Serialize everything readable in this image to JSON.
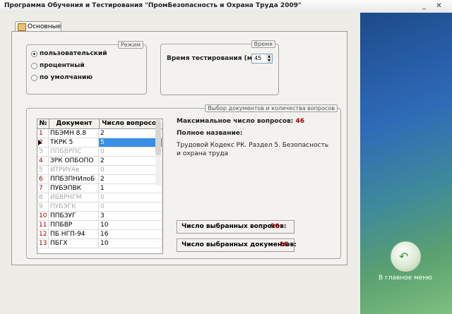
{
  "window": {
    "title": "Программа Обучения и Тестирования \"ПромБезопасность и Охрана Труда 2009\"",
    "minimize": "_",
    "close": "✕"
  },
  "tab": {
    "label": "Основные",
    "icon": "settings-icon"
  },
  "mode_group": {
    "title": "Режим",
    "options": [
      {
        "label": "пользовательский",
        "checked": true
      },
      {
        "label": "процентный",
        "checked": false
      },
      {
        "label": "по умолчанию",
        "checked": false
      }
    ]
  },
  "time_group": {
    "title": "Время",
    "label": "Время тестирования (мин):",
    "value": "45"
  },
  "docs_group": {
    "title": "Выбор документов и количества вопросов",
    "columns": [
      "№",
      "Документ",
      "Число вопросов"
    ],
    "rows": [
      {
        "num": "1",
        "doc": "ПБЭМН 8.8",
        "count": "2",
        "disabled": false,
        "selected": false
      },
      {
        "num": "2",
        "doc": "ТКРК 5",
        "count": "5",
        "disabled": false,
        "selected": true
      },
      {
        "num": "3",
        "doc": "ППБВРПС",
        "count": "0",
        "disabled": true,
        "selected": false
      },
      {
        "num": "4",
        "doc": "ЗРК ОПБОПО",
        "count": "2",
        "disabled": false,
        "selected": false
      },
      {
        "num": "5",
        "doc": "ИТРИУАв",
        "count": "0",
        "disabled": true,
        "selected": false
      },
      {
        "num": "6",
        "doc": "ППБЗПНИлоБ",
        "count": "2",
        "disabled": false,
        "selected": false
      },
      {
        "num": "7",
        "doc": "ПУБЭПВК",
        "count": "1",
        "disabled": false,
        "selected": false
      },
      {
        "num": "8",
        "doc": "ИБВРНГМ",
        "count": "0",
        "disabled": true,
        "selected": false
      },
      {
        "num": "9",
        "doc": "ПУБЭГК",
        "count": "0",
        "disabled": true,
        "selected": false
      },
      {
        "num": "10",
        "doc": "ППБЗУГ",
        "count": "3",
        "disabled": false,
        "selected": false
      },
      {
        "num": "11",
        "doc": "ППБВР",
        "count": "10",
        "disabled": false,
        "selected": false
      },
      {
        "num": "12",
        "doc": "ПБ НГП-94",
        "count": "16",
        "disabled": false,
        "selected": false
      },
      {
        "num": "13",
        "doc": "ПБГХ",
        "count": "10",
        "disabled": false,
        "selected": false
      }
    ],
    "max_label": "Максимальное число вопросов:",
    "max_value": "46",
    "fullname_label": "Полное название:",
    "fullname_value": "Трудовой Кодекс РК. Раздел 5. Безопасность и охрана труда",
    "selected_questions_label": "Число выбранных вопросов:",
    "selected_questions_value": "96",
    "selected_docs_label": "Число выбранных документов:",
    "selected_docs_value": "18"
  },
  "main_menu": {
    "label": "В главное меню",
    "icon": "back-arrow-icon"
  }
}
